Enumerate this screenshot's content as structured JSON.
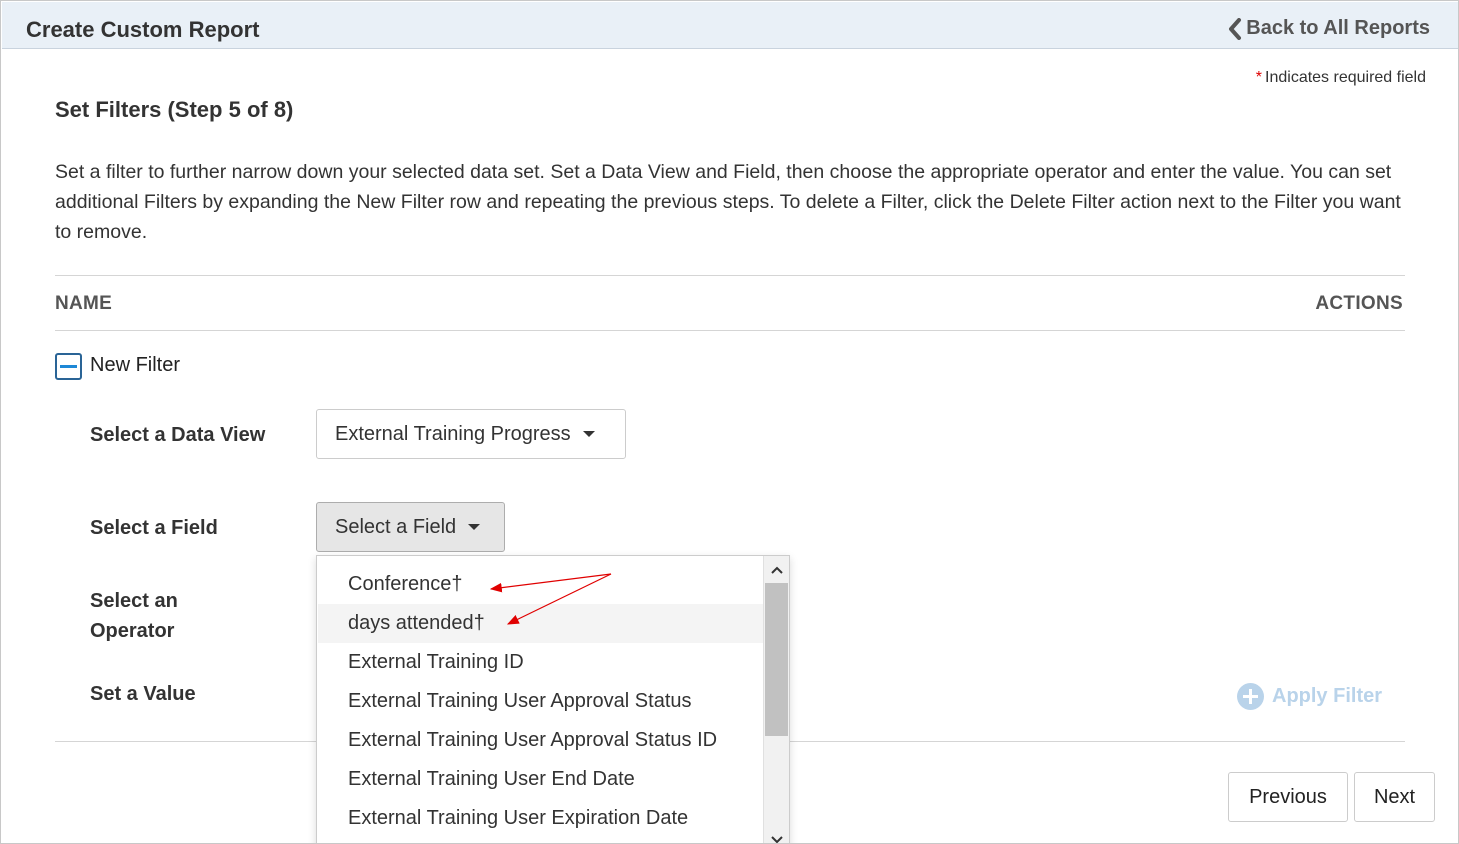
{
  "header": {
    "title": "Create Custom Report",
    "back_label": "Back to All Reports"
  },
  "required_note": {
    "star": "*",
    "text": "Indicates required field"
  },
  "step_title": "Set Filters (Step 5 of 8)",
  "description": "Set a filter to further narrow down your selected data set. Set a Data View and Field, then choose the appropriate operator and enter the value. You can set additional Filters by expanding the New Filter row and repeating the previous steps. To delete a Filter, click the Delete Filter action next to the Filter you want to remove.",
  "table": {
    "col_name": "NAME",
    "col_actions": "ACTIONS"
  },
  "filter": {
    "label": "New Filter",
    "data_view_label": "Select a Data View",
    "data_view_value": "External Training Progress",
    "field_label": "Select a Field",
    "field_value": "Select a Field",
    "operator_label": "Select an Operator",
    "value_label": "Set a Value",
    "apply_label": "Apply Filter"
  },
  "field_menu": {
    "items": [
      "Conference†",
      "days attended†",
      "External Training ID",
      "External Training User Approval Status",
      "External Training User Approval Status ID",
      "External Training User End Date",
      "External Training User Expiration Date"
    ],
    "hovered_index": 1
  },
  "nav": {
    "previous_label": "Previous",
    "next_label": "Next"
  },
  "colors": {
    "header_bg": "#e9f0f7",
    "required_star": "#dd0000",
    "apply_disabled": "#b9d3ea",
    "annotation_arrow": "#e00000",
    "toggle_accent": "#1e88d6"
  },
  "icons": {
    "back": "chevron-left-icon",
    "collapse": "minus-square-icon",
    "caret": "caret-down-icon",
    "apply": "plus-circle-icon"
  }
}
